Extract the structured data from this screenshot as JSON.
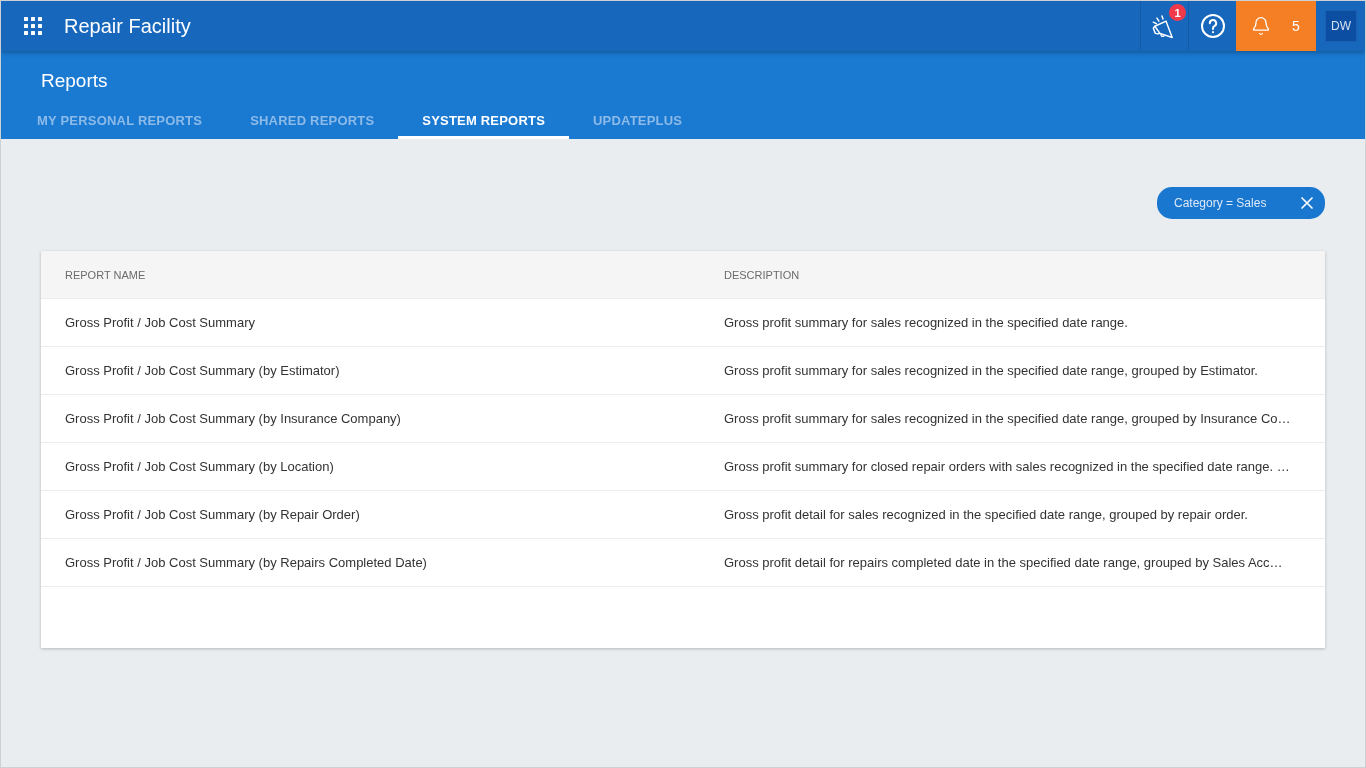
{
  "app_bar": {
    "title": "Repair Facility",
    "announcements_badge": "1",
    "notifications_count": "5",
    "user_initials": "DW"
  },
  "page": {
    "title": "Reports",
    "tabs": [
      {
        "label": "MY PERSONAL REPORTS",
        "selected": false
      },
      {
        "label": "SHARED REPORTS",
        "selected": false
      },
      {
        "label": "SYSTEM REPORTS",
        "selected": true
      },
      {
        "label": "UPDATEPLUS",
        "selected": false
      }
    ]
  },
  "filters": [
    {
      "label": "Category = Sales"
    }
  ],
  "table": {
    "columns": [
      "REPORT NAME",
      "DESCRIPTION"
    ],
    "rows": [
      {
        "name": "Gross Profit / Job Cost Summary",
        "description": "Gross profit summary for sales recognized in the specified date range."
      },
      {
        "name": "Gross Profit / Job Cost Summary (by Estimator)",
        "description": "Gross profit summary for sales recognized in the specified date range, grouped by Estimator."
      },
      {
        "name": "Gross Profit / Job Cost Summary (by Insurance Company)",
        "description": "Gross profit summary for sales recognized in the specified date range, grouped by Insurance Co…"
      },
      {
        "name": "Gross Profit / Job Cost Summary (by Location)",
        "description": "Gross profit summary for closed repair orders with sales recognized in the specified date range. …"
      },
      {
        "name": "Gross Profit / Job Cost Summary (by Repair Order)",
        "description": "Gross profit detail for sales recognized in the specified date range, grouped by repair order."
      },
      {
        "name": "Gross Profit / Job Cost Summary (by Repairs Completed Date)",
        "description": "Gross profit detail for repairs completed date in the specified date range, grouped by Sales Acc…"
      }
    ]
  }
}
